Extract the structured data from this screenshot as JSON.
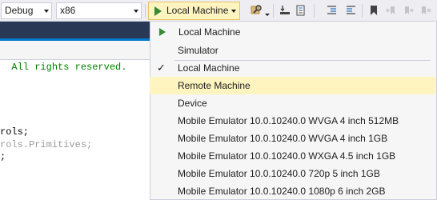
{
  "toolbar": {
    "config_combo": {
      "value": "Debug"
    },
    "platform_combo": {
      "value": "x86"
    },
    "run_button": {
      "label": "Local Machine"
    }
  },
  "editor": {
    "lines": [
      {
        "text": "All rights reserved.",
        "style": "comment",
        "prefix": "  "
      },
      {
        "text": "rols;",
        "style": "dark",
        "prefix": ""
      },
      {
        "text": "rols.Primitives;",
        "style": "grey",
        "prefix": ""
      },
      {
        "text": ";",
        "style": "dark",
        "prefix": ""
      }
    ]
  },
  "dropdown": {
    "header_item": {
      "label": "Local Machine"
    },
    "items": [
      {
        "label": "Simulator"
      },
      {
        "label": "Local Machine",
        "checked": "✓"
      },
      {
        "label": "Remote Machine"
      },
      {
        "label": "Device"
      },
      {
        "label": "Mobile Emulator 10.0.10240.0 WVGA 4 inch 512MB"
      },
      {
        "label": "Mobile Emulator 10.0.10240.0 WVGA 4 inch 1GB"
      },
      {
        "label": "Mobile Emulator 10.0.10240.0 WXGA 4.5 inch 1GB"
      },
      {
        "label": "Mobile Emulator 10.0.10240.0 720p 5 inch 1GB"
      },
      {
        "label": "Mobile Emulator 10.0.10240.0 1080p 6 inch 2GB"
      }
    ]
  },
  "colors": {
    "accent_play": "#388a34",
    "highlight": "#fdf4bf",
    "comment": "#008000",
    "tab_strip": "#293955"
  }
}
